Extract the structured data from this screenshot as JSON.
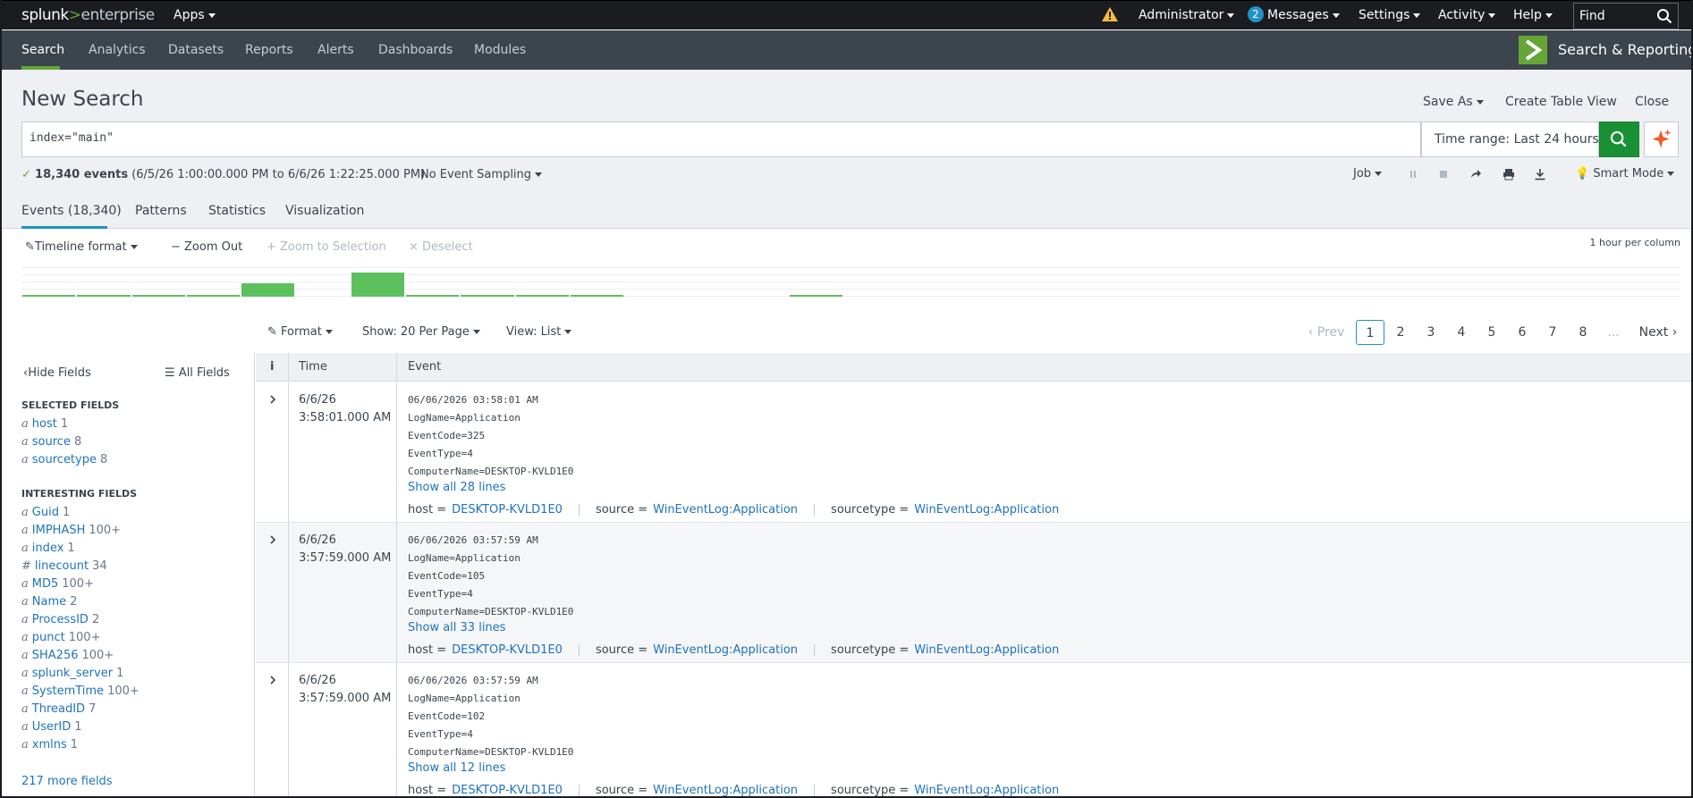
{
  "topbar": {
    "logo_main": "splunk",
    "logo_gt": ">",
    "logo_sub": "enterprise",
    "apps_label": "Apps",
    "administrator_label": "Administrator",
    "messages_count": "2",
    "messages_label": "Messages",
    "settings_label": "Settings",
    "activity_label": "Activity",
    "help_label": "Help",
    "find_placeholder": "Find"
  },
  "nav": {
    "items": [
      "Search",
      "Analytics",
      "Datasets",
      "Reports",
      "Alerts",
      "Dashboards",
      "Modules"
    ],
    "active": "Search",
    "app_name": "Search & Reporting"
  },
  "search": {
    "title": "New Search",
    "save_as": "Save As",
    "create_table_view": "Create Table View",
    "close": "Close",
    "query": "index=\"main\"",
    "time_range": "Time range: Last 24 hours",
    "events_count": "18,340 events",
    "events_range": "(6/5/26 1:00:00.000 PM to 6/6/26 1:22:25.000 PM)",
    "sampling": "No Event Sampling",
    "job": "Job",
    "smart_mode": "Smart Mode"
  },
  "tabs": [
    "Events (18,340)",
    "Patterns",
    "Statistics",
    "Visualization"
  ],
  "timeline": {
    "format": "Timeline format",
    "zoom_out": "Zoom Out",
    "zoom_selection": "Zoom to Selection",
    "deselect": "Deselect",
    "per_column": "1 hour per column",
    "bars": [
      0.05,
      0.08,
      0.05,
      0.05,
      0.55,
      0.0,
      1.0,
      0.05,
      0.05,
      0.05,
      0.05,
      0.0,
      0.0,
      0.0,
      0.08,
      0.0,
      0.0,
      0.0,
      0.0,
      0.0,
      0.0,
      0.0,
      0.0,
      0.0,
      0.0,
      0.0,
      0.0,
      0.0,
      0.0,
      0.0
    ]
  },
  "toolbar": {
    "format": "Format",
    "show": "Show: 20 Per Page",
    "view": "View: List",
    "prev": "Prev",
    "pages": [
      "1",
      "2",
      "3",
      "4",
      "5",
      "6",
      "7",
      "8"
    ],
    "ellipsis": "...",
    "next": "Next"
  },
  "sidebar": {
    "hide_fields": "Hide Fields",
    "all_fields": "All Fields",
    "selected_title": "SELECTED FIELDS",
    "selected": [
      {
        "type": "a",
        "name": "host",
        "count": "1"
      },
      {
        "type": "a",
        "name": "source",
        "count": "8"
      },
      {
        "type": "a",
        "name": "sourcetype",
        "count": "8"
      }
    ],
    "interesting_title": "INTERESTING FIELDS",
    "interesting": [
      {
        "type": "a",
        "name": "Guid",
        "count": "1"
      },
      {
        "type": "a",
        "name": "IMPHASH",
        "count": "100+"
      },
      {
        "type": "a",
        "name": "index",
        "count": "1"
      },
      {
        "type": "#",
        "name": "linecount",
        "count": "34"
      },
      {
        "type": "a",
        "name": "MD5",
        "count": "100+"
      },
      {
        "type": "a",
        "name": "Name",
        "count": "2"
      },
      {
        "type": "a",
        "name": "ProcessID",
        "count": "2"
      },
      {
        "type": "a",
        "name": "punct",
        "count": "100+"
      },
      {
        "type": "a",
        "name": "SHA256",
        "count": "100+"
      },
      {
        "type": "a",
        "name": "splunk_server",
        "count": "1"
      },
      {
        "type": "a",
        "name": "SystemTime",
        "count": "100+"
      },
      {
        "type": "a",
        "name": "ThreadID",
        "count": "7"
      },
      {
        "type": "a",
        "name": "UserID",
        "count": "1"
      },
      {
        "type": "a",
        "name": "xmlns",
        "count": "1"
      }
    ],
    "more_fields": "217 more fields"
  },
  "results": {
    "col_info": "i",
    "col_time": "Time",
    "col_event": "Event",
    "events": [
      {
        "date": "6/6/26",
        "time": "3:58:01.000 AM",
        "lines": [
          "06/06/2026 03:58:01 AM",
          "LogName=Application",
          "EventCode=325",
          "EventType=4",
          "ComputerName=DESKTOP-KVLD1E0"
        ],
        "show_all": "Show all 28 lines",
        "host": "DESKTOP-KVLD1E0",
        "source": "WinEventLog:Application",
        "sourcetype": "WinEventLog:Application"
      },
      {
        "date": "6/6/26",
        "time": "3:57:59.000 AM",
        "lines": [
          "06/06/2026 03:57:59 AM",
          "LogName=Application",
          "EventCode=105",
          "EventType=4",
          "ComputerName=DESKTOP-KVLD1E0"
        ],
        "show_all": "Show all 33 lines",
        "host": "DESKTOP-KVLD1E0",
        "source": "WinEventLog:Application",
        "sourcetype": "WinEventLog:Application"
      },
      {
        "date": "6/6/26",
        "time": "3:57:59.000 AM",
        "lines": [
          "06/06/2026 03:57:59 AM",
          "LogName=Application",
          "EventCode=102",
          "EventType=4",
          "ComputerName=DESKTOP-KVLD1E0"
        ],
        "show_all": "Show all 12 lines",
        "host": "DESKTOP-KVLD1E0",
        "source": "WinEventLog:Application",
        "sourcetype": "WinEventLog:Application"
      }
    ],
    "meta_host_key": "host =",
    "meta_source_key": "source =",
    "meta_sourcetype_key": "sourcetype ="
  },
  "colors": {
    "accent_green": "#65a637",
    "link_blue": "#1e73be",
    "topbar_bg": "#1a1c20",
    "navbar_bg": "#3c444d"
  }
}
